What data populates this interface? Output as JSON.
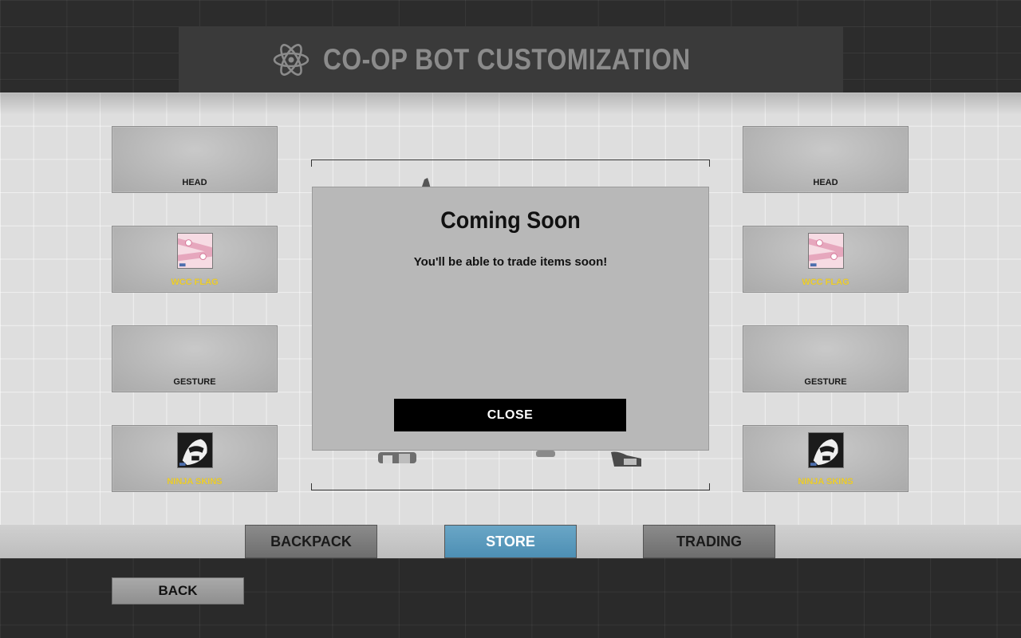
{
  "header": {
    "title": "CO-OP BOT CUSTOMIZATION",
    "icon": "atom-icon"
  },
  "left_slots": [
    {
      "label": "HEAD",
      "has_item": false
    },
    {
      "label": "WCC FLAG",
      "has_item": true,
      "icon": "flag-thumbnail-icon"
    },
    {
      "label": "GESTURE",
      "has_item": false
    },
    {
      "label": "NINJA SKINS",
      "has_item": true,
      "icon": "ninja-thumbnail-icon"
    }
  ],
  "right_slots": [
    {
      "label": "HEAD",
      "has_item": false
    },
    {
      "label": "WCC FLAG",
      "has_item": true,
      "icon": "flag-thumbnail-icon"
    },
    {
      "label": "GESTURE",
      "has_item": false
    },
    {
      "label": "NINJA SKINS",
      "has_item": true,
      "icon": "ninja-thumbnail-icon"
    }
  ],
  "modal": {
    "title": "Coming Soon",
    "message": "You'll be able to trade items soon!",
    "close_label": "CLOSE"
  },
  "tabs": [
    {
      "label": "BACKPACK",
      "active": false
    },
    {
      "label": "STORE",
      "active": true
    },
    {
      "label": "TRADING",
      "active": false
    }
  ],
  "back_label": "BACK",
  "colors": {
    "item_label_yellow": "#f2d22e",
    "active_tab": "#5a9bbf",
    "title_gray": "#8b8b8b"
  }
}
